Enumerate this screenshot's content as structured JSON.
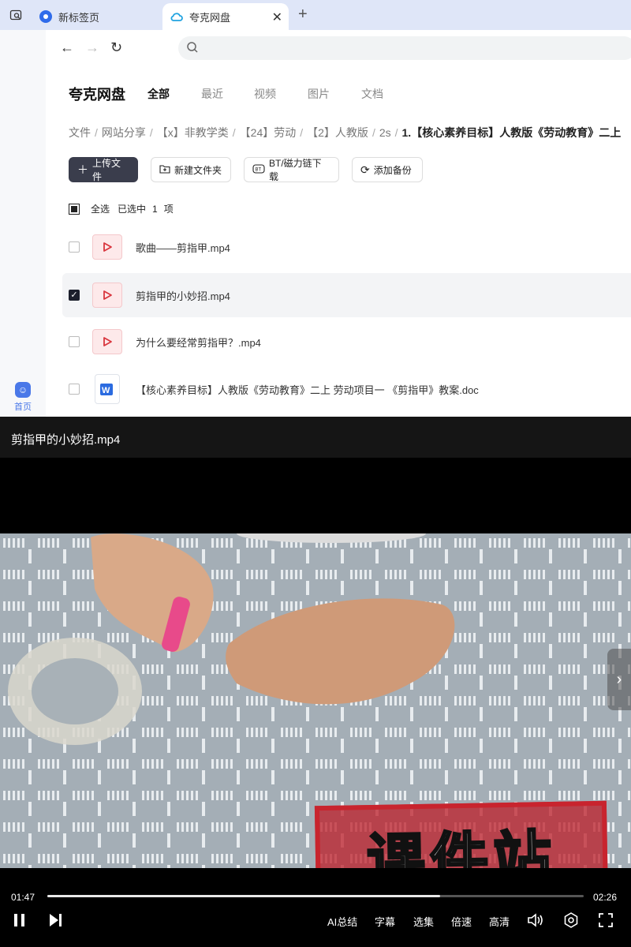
{
  "browser": {
    "tabs": [
      {
        "title": "新标签页"
      },
      {
        "title": "夸克网盘"
      }
    ]
  },
  "rail": {
    "home_label": "首页"
  },
  "header": {
    "brand": "夸克网盘",
    "tabs": [
      "全部",
      "最近",
      "视频",
      "图片",
      "文档"
    ],
    "active_tab": "全部"
  },
  "breadcrumb": [
    "文件",
    "网站分享",
    "【x】非教学类",
    "【24】劳动",
    "【2】人教版",
    "2s",
    "1.【核心素养目标】人教版《劳动教育》二上"
  ],
  "toolbar": {
    "upload": "上传文件",
    "new_folder": "新建文件夹",
    "bt_download": "BT/磁力链下载",
    "add_backup": "添加备份"
  },
  "selection": {
    "select_all": "全选",
    "selected_prefix": "已选中",
    "count": "1",
    "unit": "项"
  },
  "files": [
    {
      "name": "歌曲——剪指甲.mp4",
      "type": "video",
      "checked": false
    },
    {
      "name": "剪指甲的小妙招.mp4",
      "type": "video",
      "checked": true
    },
    {
      "name": "为什么要经常剪指甲？.mp4",
      "type": "video",
      "checked": false
    },
    {
      "name": "【核心素养目标】人教版《劳动教育》二上 劳动项目一 《剪指甲》教案.doc",
      "type": "doc",
      "checked": false
    }
  ],
  "player": {
    "title": "剪指甲的小妙招.mp4",
    "current_time": "01:47",
    "duration": "02:26",
    "progress": 0.733,
    "controls": [
      "AI总结",
      "字幕",
      "选集",
      "倍速",
      "高清"
    ],
    "watermark": "课件站"
  },
  "colors": {
    "accent": "#4a78e8",
    "primary_button": "#3a3d4c",
    "video_icon": "#d9363e"
  }
}
